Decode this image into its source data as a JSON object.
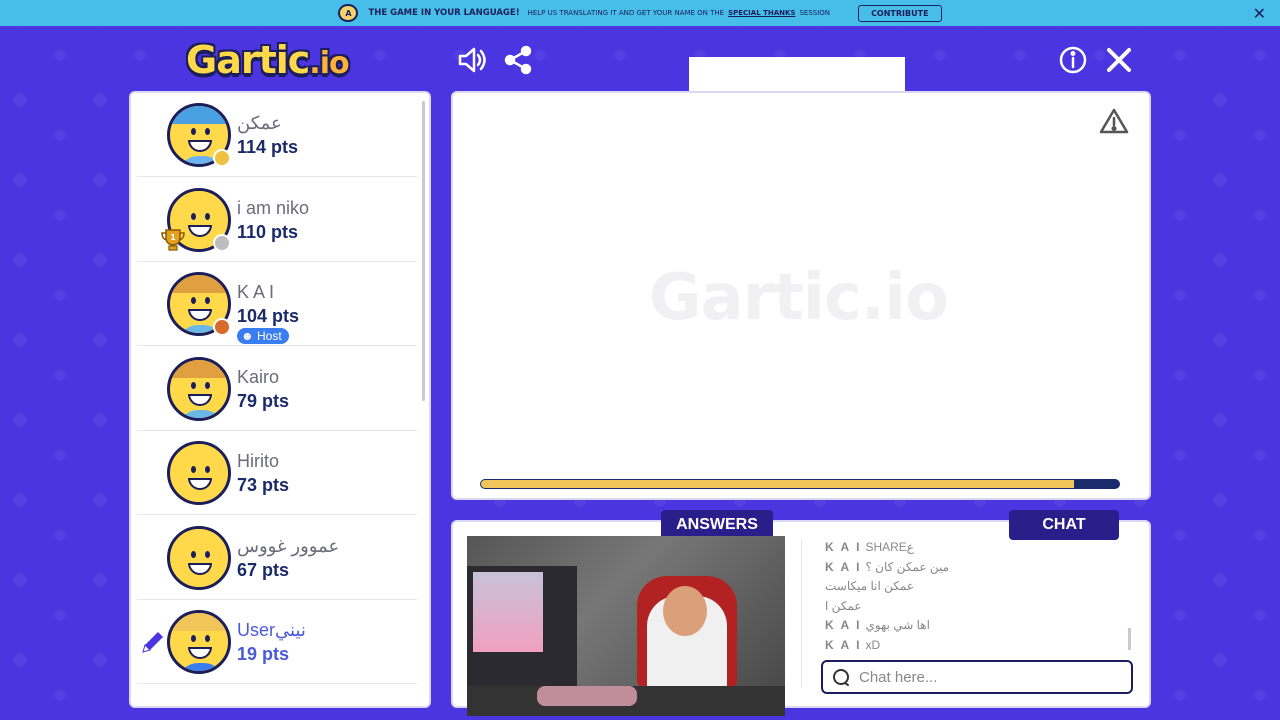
{
  "banner": {
    "title": "THE GAME IN YOUR LANGUAGE!",
    "text": "HELP US TRANSLATING IT AND GET YOUR NAME ON THE",
    "link": "SPECIAL THANKS",
    "tail": "SESSION",
    "button": "CONTRIBUTE",
    "badge": "A"
  },
  "logo": {
    "g": "Gartic",
    "io": ".io"
  },
  "icons": {
    "sound": "sound-icon",
    "share": "share-icon",
    "info": "info-icon",
    "close": "close-icon",
    "warning": "warning-icon",
    "search": "chat-bubble-icon",
    "pencil": "pencil-icon",
    "trophy": "trophy-icon"
  },
  "players": [
    {
      "name": "عمكن",
      "points": "114 pts",
      "status_color": "#f0c040",
      "hair": "#4aa0e0",
      "shirt": "#69b4f0"
    },
    {
      "name": "i am niko",
      "points": "110 pts",
      "status_color": "#bdbdbd",
      "hair": "#ffd94a",
      "shirt": "#ffd94a",
      "rank": "1"
    },
    {
      "name": "K A I",
      "points": "104 pts",
      "status_color": "#d86a2a",
      "hair": "#e0a040",
      "shirt": "#6ab8e8",
      "host": "Host"
    },
    {
      "name": "Kairo",
      "points": "79 pts",
      "hair": "#e0a040",
      "shirt": "#6ab8e8"
    },
    {
      "name": "Hirito",
      "points": "73 pts",
      "hair": "#ffd94a",
      "shirt": "#ffd94a"
    },
    {
      "name": "عموور غووس",
      "points": "67 pts",
      "hair": "#ffd94a",
      "shirt": "#ffd94a"
    },
    {
      "name": "Userنيني",
      "points": "19 pts",
      "hair": "#f2c55a",
      "shirt": "#3a7df0",
      "me": true
    }
  ],
  "canvas": {
    "watermark": "Gartic.io",
    "timer_fraction": 0.93
  },
  "tabs": {
    "answers": "ANSWERS",
    "chat": "CHAT"
  },
  "chat": {
    "lines": [
      {
        "user": "K A I",
        "text": "SHAREع"
      },
      {
        "user": "K A I",
        "text": "مين عمكن كان ؟"
      },
      {
        "user": "",
        "text": "عمكن انا ميكاست"
      },
      {
        "user": "",
        "text": "عمكن ا"
      },
      {
        "user": "K A I",
        "text": "اها شي بهوي"
      },
      {
        "user": "K A I",
        "text": "xD"
      }
    ],
    "placeholder": "Chat here..."
  }
}
